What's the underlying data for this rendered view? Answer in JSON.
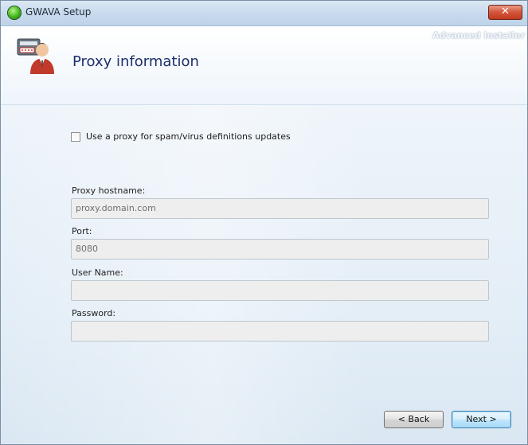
{
  "window": {
    "title": "GWAVA Setup",
    "close_label": "✕",
    "brand": "Advanced Installer"
  },
  "header": {
    "title": "Proxy information",
    "icon": "user-with-credentials-icon"
  },
  "form": {
    "use_proxy": {
      "label": "Use a proxy for spam/virus definitions updates",
      "checked": false
    },
    "hostname": {
      "label": "Proxy hostname:",
      "value": "proxy.domain.com"
    },
    "port": {
      "label": "Port:",
      "value": "8080"
    },
    "username": {
      "label": "User Name:",
      "value": ""
    },
    "password": {
      "label": "Password:",
      "value": ""
    }
  },
  "buttons": {
    "back": "< Back",
    "next": "Next >"
  },
  "colors": {
    "title_text": "#1c2f6b",
    "close_button": "#c13a1f",
    "accent": "#3c7fb1"
  }
}
